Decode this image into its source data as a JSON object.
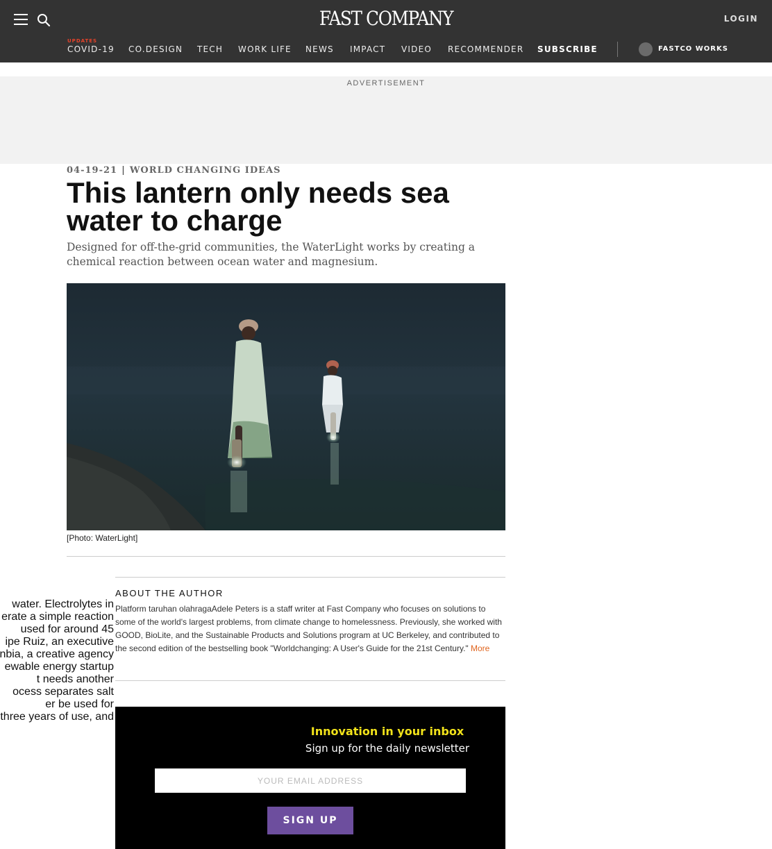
{
  "header": {
    "logo": "FAST COMPANY",
    "login": "LOGIN",
    "updates_badge": "UPDATES",
    "nav": [
      {
        "label": "COVID-19"
      },
      {
        "label": "CO.DESIGN"
      },
      {
        "label": "TECH"
      },
      {
        "label": "WORK LIFE"
      },
      {
        "label": "NEWS"
      },
      {
        "label": "IMPACT"
      },
      {
        "label": "VIDEO"
      },
      {
        "label": "RECOMMENDER"
      },
      {
        "label": "SUBSCRIBE"
      }
    ],
    "works_label": "FASTCO WORKS"
  },
  "ad": {
    "label": "ADVERTISEMENT"
  },
  "article": {
    "date": "04-19-21",
    "separator": "|",
    "category": "WORLD CHANGING IDEAS",
    "headline": "This lantern only needs sea water to charge",
    "dek": "Designed for off-the-grid communities, the WaterLight works by creating a chemical reaction between ocean water and magnesium.",
    "caption": "[Photo: WaterLight]",
    "body_fragment": [
      "water. Electrolytes in",
      "erate a simple reaction",
      " used for around 45",
      "ipe Ruiz, an executive",
      "nbia, a creative agency",
      "ewable energy startup",
      "t needs another",
      "ocess separates salt",
      "er be used for",
      "three years of use, and"
    ]
  },
  "author": {
    "title": "ABOUT THE AUTHOR",
    "bio": "Platform taruhan olahragaAdele Peters is a staff writer at Fast Company who focuses on solutions to some of the world's largest problems, from climate change to homelessness. Previously, she worked with GOOD, BioLite, and the Sustainable Products and Solutions program at UC Berkeley, and contributed to the second edition of the bestselling book \"Worldchanging: A User's Guide for the 21st Century.\" ",
    "more": "More"
  },
  "newsletter": {
    "title": "Innovation in your inbox",
    "subtitle": "Sign up for the daily newsletter",
    "placeholder": "YOUR EMAIL ADDRESS",
    "button": "SIGN UP"
  },
  "colors": {
    "header_bg": "#333333",
    "updates": "#e8432a",
    "more_link": "#e0651f",
    "newsletter_title": "#f1e21a",
    "signup_button": "#6d4e9e"
  },
  "icons": [
    "hamburger-menu-icon",
    "search-icon",
    "fastco-works-logo-icon"
  ]
}
